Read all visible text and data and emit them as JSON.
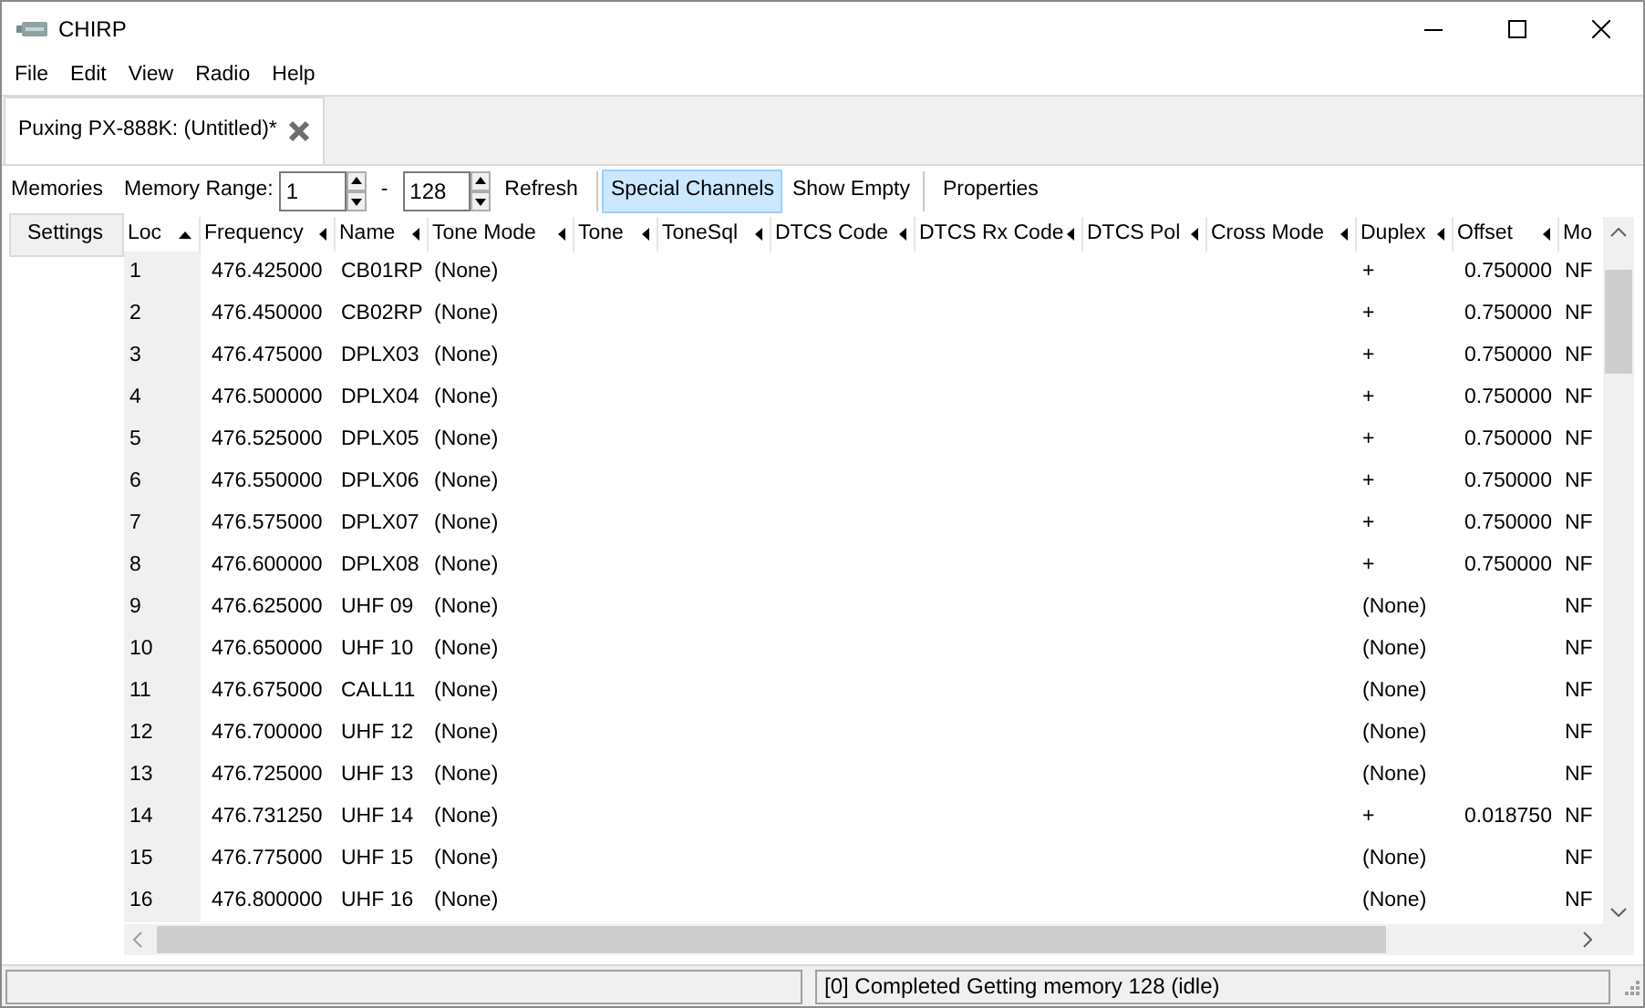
{
  "window": {
    "title": "CHIRP"
  },
  "menu": [
    "File",
    "Edit",
    "View",
    "Radio",
    "Help"
  ],
  "tabs": [
    {
      "label": "Puxing PX-888K: (Untitled)*",
      "selected": true
    }
  ],
  "side_tabs": [
    {
      "label": "Memories",
      "selected": true
    },
    {
      "label": "Settings",
      "selected": false
    }
  ],
  "toolbar": {
    "range_label": "Memory Range:",
    "range_start": "1",
    "range_separator": "-",
    "range_end": "128",
    "refresh": "Refresh",
    "special_channels": {
      "label": "Special Channels",
      "selected": true
    },
    "show_empty": {
      "label": "Show Empty",
      "selected": false
    },
    "properties": "Properties"
  },
  "table": {
    "columns": [
      {
        "label": "Loc",
        "sorted": true
      },
      {
        "label": "Frequency",
        "sorted": false
      },
      {
        "label": "Name",
        "sorted": false
      },
      {
        "label": "Tone Mode",
        "sorted": false
      },
      {
        "label": "Tone",
        "sorted": false
      },
      {
        "label": "ToneSql",
        "sorted": false
      },
      {
        "label": "DTCS Code",
        "sorted": false
      },
      {
        "label": "DTCS Rx Code",
        "sorted": false
      },
      {
        "label": "DTCS Pol",
        "sorted": false
      },
      {
        "label": "Cross Mode",
        "sorted": false
      },
      {
        "label": "Duplex",
        "sorted": false
      },
      {
        "label": "Offset",
        "sorted": false
      },
      {
        "label": "Mo"
      }
    ],
    "rows": [
      [
        "1",
        "476.425000",
        "CB01RP",
        "(None)",
        "",
        "",
        "",
        "",
        "",
        "",
        "+",
        "0.750000",
        "NF"
      ],
      [
        "2",
        "476.450000",
        "CB02RP",
        "(None)",
        "",
        "",
        "",
        "",
        "",
        "",
        "+",
        "0.750000",
        "NF"
      ],
      [
        "3",
        "476.475000",
        "DPLX03",
        "(None)",
        "",
        "",
        "",
        "",
        "",
        "",
        "+",
        "0.750000",
        "NF"
      ],
      [
        "4",
        "476.500000",
        "DPLX04",
        "(None)",
        "",
        "",
        "",
        "",
        "",
        "",
        "+",
        "0.750000",
        "NF"
      ],
      [
        "5",
        "476.525000",
        "DPLX05",
        "(None)",
        "",
        "",
        "",
        "",
        "",
        "",
        "+",
        "0.750000",
        "NF"
      ],
      [
        "6",
        "476.550000",
        "DPLX06",
        "(None)",
        "",
        "",
        "",
        "",
        "",
        "",
        "+",
        "0.750000",
        "NF"
      ],
      [
        "7",
        "476.575000",
        "DPLX07",
        "(None)",
        "",
        "",
        "",
        "",
        "",
        "",
        "+",
        "0.750000",
        "NF"
      ],
      [
        "8",
        "476.600000",
        "DPLX08",
        "(None)",
        "",
        "",
        "",
        "",
        "",
        "",
        "+",
        "0.750000",
        "NF"
      ],
      [
        "9",
        "476.625000",
        "UHF 09",
        "(None)",
        "",
        "",
        "",
        "",
        "",
        "",
        "(None)",
        "",
        "NF"
      ],
      [
        "10",
        "476.650000",
        "UHF 10",
        "(None)",
        "",
        "",
        "",
        "",
        "",
        "",
        "(None)",
        "",
        "NF"
      ],
      [
        "11",
        "476.675000",
        "CALL11",
        "(None)",
        "",
        "",
        "",
        "",
        "",
        "",
        "(None)",
        "",
        "NF"
      ],
      [
        "12",
        "476.700000",
        "UHF 12",
        "(None)",
        "",
        "",
        "",
        "",
        "",
        "",
        "(None)",
        "",
        "NF"
      ],
      [
        "13",
        "476.725000",
        "UHF 13",
        "(None)",
        "",
        "",
        "",
        "",
        "",
        "",
        "(None)",
        "",
        "NF"
      ],
      [
        "14",
        "476.731250",
        "UHF 14",
        "(None)",
        "",
        "",
        "",
        "",
        "",
        "",
        "+",
        "0.018750",
        "NF"
      ],
      [
        "15",
        "476.775000",
        "UHF 15",
        "(None)",
        "",
        "",
        "",
        "",
        "",
        "",
        "(None)",
        "",
        "NF"
      ],
      [
        "16",
        "476.800000",
        "UHF 16",
        "(None)",
        "",
        "",
        "",
        "",
        "",
        "",
        "(None)",
        "",
        "NF"
      ]
    ]
  },
  "status_bar": {
    "message": "[0] Completed Getting memory 128 (idle)"
  }
}
